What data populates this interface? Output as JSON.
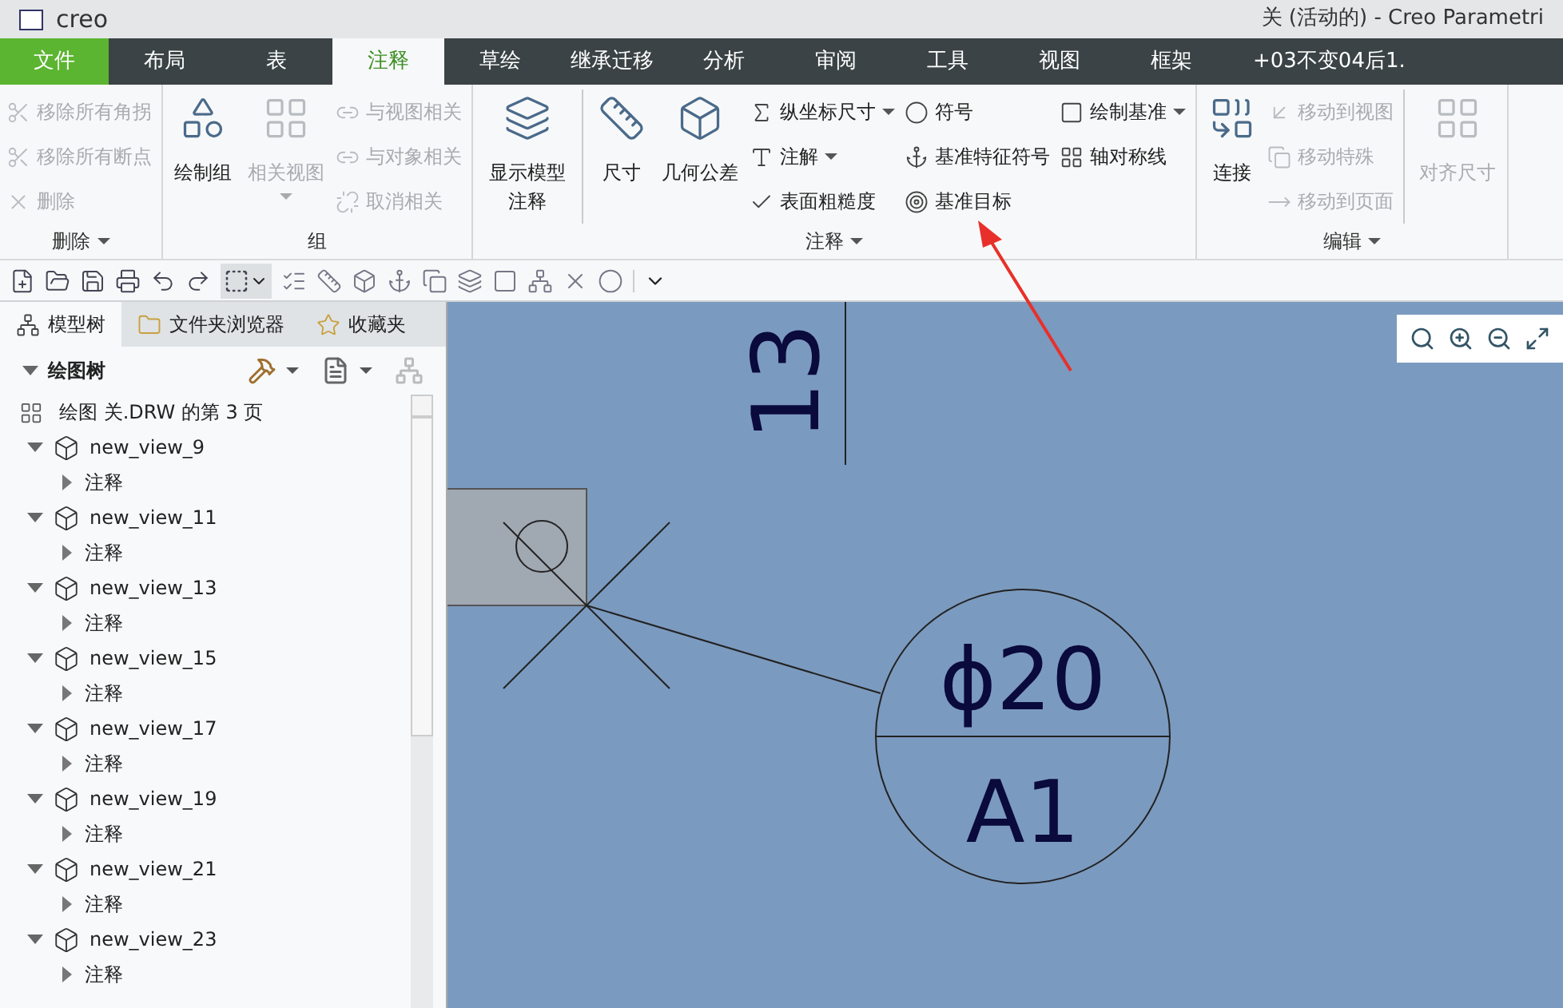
{
  "window": {
    "app_name": "creo",
    "title": "关 (活动的) - Creo Parametri"
  },
  "menu_tabs": [
    {
      "label": "文件",
      "kind": "file",
      "selected": false
    },
    {
      "label": "布局",
      "kind": "tab",
      "selected": false
    },
    {
      "label": "表",
      "kind": "tab",
      "selected": false
    },
    {
      "label": "注释",
      "kind": "tab",
      "selected": true
    },
    {
      "label": "草绘",
      "kind": "tab",
      "selected": false
    },
    {
      "label": "继承迁移",
      "kind": "tab",
      "selected": false
    },
    {
      "label": "分析",
      "kind": "tab",
      "selected": false
    },
    {
      "label": "审阅",
      "kind": "tab",
      "selected": false
    },
    {
      "label": "工具",
      "kind": "tab",
      "selected": false
    },
    {
      "label": "视图",
      "kind": "tab",
      "selected": false
    },
    {
      "label": "框架",
      "kind": "tab",
      "selected": false
    },
    {
      "label": "+03不变04后1.",
      "kind": "tab",
      "selected": false
    }
  ],
  "ribbon": {
    "groups": [
      {
        "label": "删除",
        "dropdown": true,
        "columns": [
          {
            "separated": false,
            "items": [
              {
                "label": "移除所有角拐",
                "kind": "small",
                "disabled": true,
                "dropdown": false
              },
              {
                "label": "移除所有断点",
                "kind": "small",
                "disabled": true,
                "dropdown": false
              },
              {
                "label": "删除",
                "kind": "small",
                "disabled": true,
                "dropdown": false
              }
            ]
          }
        ]
      },
      {
        "label": "组",
        "dropdown": false,
        "columns": [
          {
            "separated": false,
            "items": [
              {
                "label": "绘制组",
                "kind": "large",
                "disabled": false,
                "dropdown": false
              }
            ]
          },
          {
            "separated": false,
            "items": [
              {
                "label": "相关视图",
                "kind": "large",
                "disabled": true,
                "dropdown": true
              }
            ]
          },
          {
            "separated": false,
            "items": [
              {
                "label": "与视图相关",
                "kind": "small",
                "disabled": true,
                "dropdown": false
              },
              {
                "label": "与对象相关",
                "kind": "small",
                "disabled": true,
                "dropdown": false
              },
              {
                "label": "取消相关",
                "kind": "small",
                "disabled": true,
                "dropdown": false
              }
            ]
          }
        ]
      },
      {
        "label": "注释",
        "dropdown": true,
        "columns": [
          {
            "separated": false,
            "items": [
              {
                "label": "显示模型注释",
                "kind": "large",
                "disabled": false,
                "dropdown": false
              }
            ]
          },
          {
            "separated": true,
            "items": [
              {
                "label": "尺寸",
                "kind": "large",
                "disabled": false,
                "dropdown": false
              }
            ]
          },
          {
            "separated": false,
            "items": [
              {
                "label": "几何公差",
                "kind": "large",
                "disabled": false,
                "dropdown": false
              }
            ]
          },
          {
            "separated": false,
            "items": [
              {
                "label": "纵坐标尺寸",
                "kind": "small",
                "disabled": false,
                "dropdown": true
              },
              {
                "label": "注解",
                "kind": "small",
                "disabled": false,
                "dropdown": true
              },
              {
                "label": "表面粗糙度",
                "kind": "small",
                "disabled": false,
                "dropdown": false
              }
            ]
          },
          {
            "separated": false,
            "items": [
              {
                "label": "符号",
                "kind": "small",
                "disabled": false,
                "dropdown": false
              },
              {
                "label": "基准特征符号",
                "kind": "small",
                "disabled": false,
                "dropdown": false
              },
              {
                "label": "基准目标",
                "kind": "small",
                "disabled": false,
                "dropdown": false
              }
            ]
          },
          {
            "separated": false,
            "items": [
              {
                "label": "绘制基准",
                "kind": "small",
                "disabled": false,
                "dropdown": true
              },
              {
                "label": "轴对称线",
                "kind": "small",
                "disabled": false,
                "dropdown": false
              }
            ]
          }
        ]
      },
      {
        "label": "编辑",
        "dropdown": true,
        "columns": [
          {
            "separated": false,
            "items": [
              {
                "label": "连接",
                "kind": "large",
                "disabled": false,
                "dropdown": false
              }
            ]
          },
          {
            "separated": false,
            "items": [
              {
                "label": "移动到视图",
                "kind": "small",
                "disabled": true,
                "dropdown": false
              },
              {
                "label": "移动特殊",
                "kind": "small",
                "disabled": true,
                "dropdown": false
              },
              {
                "label": "移动到页面",
                "kind": "small",
                "disabled": true,
                "dropdown": false
              }
            ]
          },
          {
            "separated": true,
            "items": [
              {
                "label": "对齐尺寸",
                "kind": "large",
                "disabled": true,
                "dropdown": false
              }
            ]
          }
        ]
      }
    ]
  },
  "panel_tabs": [
    {
      "label": "模型树",
      "selected": true
    },
    {
      "label": "文件夹浏览器",
      "selected": false
    },
    {
      "label": "收藏夹",
      "selected": false
    }
  ],
  "tree": {
    "title": "绘图树",
    "expanded": true,
    "sheet": "绘图 关.DRW 的第 3 页",
    "items": [
      {
        "label": "new_view_9",
        "expanded": true,
        "children": [
          {
            "label": "注释",
            "expanded": false
          }
        ]
      },
      {
        "label": "new_view_11",
        "expanded": true,
        "children": [
          {
            "label": "注释",
            "expanded": false
          }
        ]
      },
      {
        "label": "new_view_13",
        "expanded": true,
        "children": [
          {
            "label": "注释",
            "expanded": false
          }
        ]
      },
      {
        "label": "new_view_15",
        "expanded": true,
        "children": [
          {
            "label": "注释",
            "expanded": false
          }
        ]
      },
      {
        "label": "new_view_17",
        "expanded": true,
        "children": [
          {
            "label": "注释",
            "expanded": false
          }
        ]
      },
      {
        "label": "new_view_19",
        "expanded": true,
        "children": [
          {
            "label": "注释",
            "expanded": false
          }
        ]
      },
      {
        "label": "new_view_21",
        "expanded": true,
        "children": [
          {
            "label": "注释",
            "expanded": false
          }
        ]
      },
      {
        "label": "new_view_23",
        "expanded": true,
        "children": [
          {
            "label": "注释",
            "expanded": false
          }
        ]
      }
    ]
  },
  "drawing": {
    "dimension": "13",
    "datum_target_size": "ϕ20",
    "datum_target_label": "A1"
  }
}
